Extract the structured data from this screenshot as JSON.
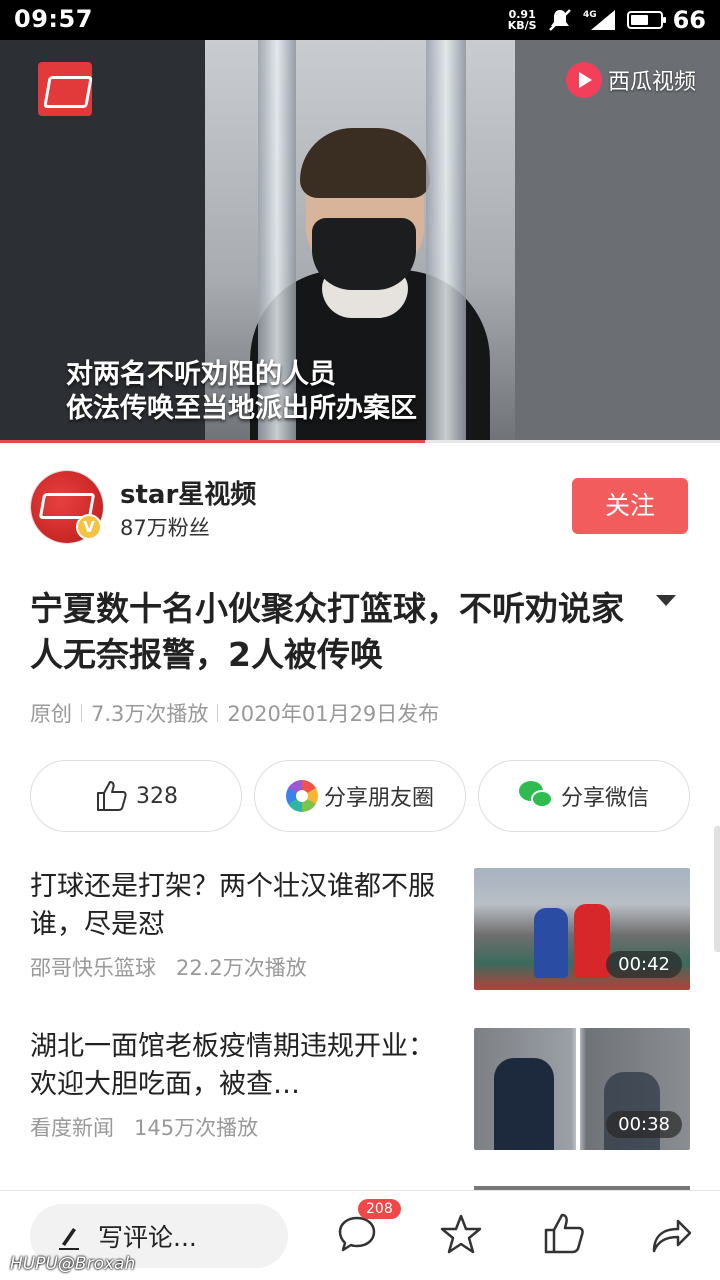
{
  "status_bar": {
    "time": "09:57",
    "net_speed_value": "0.91",
    "net_speed_unit": "KB/S",
    "network": "4G",
    "battery_level": "66",
    "battery_fraction": 0.66
  },
  "video": {
    "provider_name": "西瓜视频",
    "subtitle_line1": "对两名不听劝阻的人员",
    "subtitle_line2": "依法传唤至当地派出所办案区",
    "progress_fraction": 0.59
  },
  "author": {
    "name": "star星视频",
    "fans": "87万粉丝",
    "verified_mark": "V",
    "follow_label": "关注"
  },
  "article": {
    "title": "宁夏数十名小伙聚众打篮球，不听劝说家人无奈报警，2人被传唤",
    "meta": [
      "原创",
      "7.3万次播放",
      "2020年01月29日发布"
    ]
  },
  "actions": {
    "like_count": "328",
    "moments_label": "分享朋友圈",
    "wechat_label": "分享微信"
  },
  "related": [
    {
      "title": "打球还是打架？两个壮汉谁都不服谁，尽是怼",
      "source": "邵哥快乐篮球",
      "plays": "22.2万次播放",
      "duration": "00:42"
    },
    {
      "title": "湖北一面馆老板疫情期违规开业：欢迎大胆吃面，被查…",
      "source": "看度新闻",
      "plays": "145万次播放",
      "duration": "00:38"
    }
  ],
  "bottom_bar": {
    "comment_placeholder": "写评论...",
    "comment_count": "208"
  },
  "watermark": {
    "brand": "HUPU",
    "user": "@Broxah"
  },
  "colors": {
    "accent": "#f25c5c",
    "wechat_green": "#2ebc4f",
    "badge_red": "#f04848"
  }
}
